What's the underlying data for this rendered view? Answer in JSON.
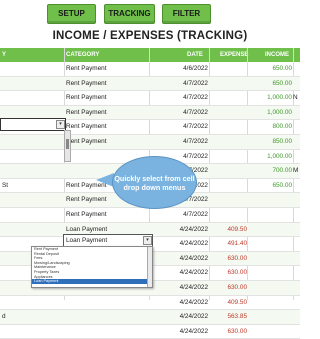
{
  "toolbar": {
    "setup": "SETUP",
    "tracking": "TRACKING",
    "filter": "FILTER"
  },
  "title": "INCOME / EXPENSES (TRACKING)",
  "headers": {
    "col0": "Y",
    "category": "CATEGORY",
    "date": "DATE",
    "expense": "EXPENSE",
    "income": "INCOME"
  },
  "rows": [
    {
      "c0": "",
      "category": "Rent Payment",
      "date": "4/6/2022",
      "expense": "",
      "income": "650.00",
      "c5": ""
    },
    {
      "c0": "",
      "category": "Rent Payment",
      "date": "4/7/2022",
      "expense": "",
      "income": "650.00",
      "c5": ""
    },
    {
      "c0": "",
      "category": "Rent Payment",
      "date": "4/7/2022",
      "expense": "",
      "income": "1,000.00",
      "c5": "N"
    },
    {
      "c0": "",
      "category": "Rent Payment",
      "date": "4/7/2022",
      "expense": "",
      "income": "1,000.00",
      "c5": ""
    },
    {
      "c0": "",
      "category": "Rent Payment",
      "date": "4/7/2022",
      "expense": "",
      "income": "800.00",
      "c5": ""
    },
    {
      "c0": "",
      "category": "Rent Payment",
      "date": "4/7/2022",
      "expense": "",
      "income": "850.00",
      "c5": ""
    },
    {
      "c0": "",
      "category": "",
      "date": "4/7/2022",
      "expense": "",
      "income": "1,000.00",
      "c5": ""
    },
    {
      "c0": "",
      "category": "",
      "date": "4/7/2022",
      "expense": "",
      "income": "700.00",
      "c5": "M"
    },
    {
      "c0": "St",
      "category": "Rent Payment",
      "date": "4/7/2022",
      "expense": "",
      "income": "650.00",
      "c5": ""
    },
    {
      "c0": "",
      "category": "Rent Payment",
      "date": "4/7/2022",
      "expense": "",
      "income": "",
      "c5": ""
    },
    {
      "c0": "",
      "category": "Rent Payment",
      "date": "4/7/2022",
      "expense": "",
      "income": "",
      "c5": ""
    },
    {
      "c0": "",
      "category": "Loan Payment",
      "date": "4/24/2022",
      "expense": "409.50",
      "income": "",
      "c5": ""
    },
    {
      "c0": "",
      "category": "Loan Payment",
      "date": "4/24/2022",
      "expense": "491.40",
      "income": "",
      "c5": ""
    },
    {
      "c0": "",
      "category": "Loan Payment",
      "date": "4/24/2022",
      "expense": "630.00",
      "income": "",
      "c5": ""
    },
    {
      "c0": "",
      "category": "",
      "date": "4/24/2022",
      "expense": "630.00",
      "income": "",
      "c5": ""
    },
    {
      "c0": "",
      "category": "",
      "date": "4/24/2022",
      "expense": "630.00",
      "income": "",
      "c5": ""
    },
    {
      "c0": "",
      "category": "",
      "date": "4/24/2022",
      "expense": "409.50",
      "income": "",
      "c5": ""
    },
    {
      "c0": "d",
      "category": "",
      "date": "4/24/2022",
      "expense": "563.85",
      "income": "",
      "c5": ""
    },
    {
      "c0": "",
      "category": "",
      "date": "4/24/2022",
      "expense": "630.00",
      "income": "",
      "c5": ""
    }
  ],
  "dropdown_items": [
    "Rent Payment",
    "Rental Deposit",
    "Fees",
    "Mowing/Landscaping",
    "Maintenance",
    "Property Taxes",
    "Appliances",
    "Loan Payment"
  ],
  "callout": "Quickly select from cell drop down menus"
}
